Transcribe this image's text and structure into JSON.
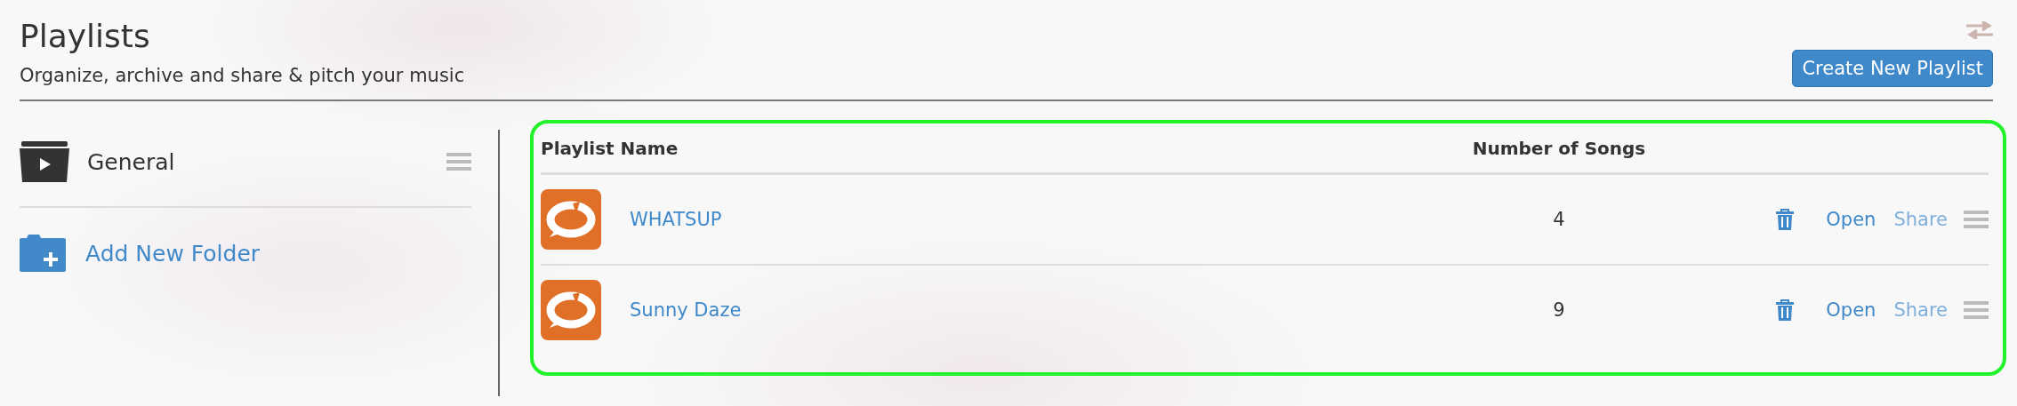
{
  "header": {
    "title": "Playlists",
    "subtitle": "Organize, archive and share & pitch your music",
    "create_button": "Create New Playlist"
  },
  "sidebar": {
    "folders": [
      {
        "name": "General"
      }
    ],
    "add_folder": "Add New Folder"
  },
  "table": {
    "columns": [
      "Playlist Name",
      "Number of Songs"
    ],
    "rows": [
      {
        "name": "WHATSUP",
        "songs": "4",
        "open": "Open",
        "share": "Share"
      },
      {
        "name": "Sunny Daze",
        "songs": "9",
        "open": "Open",
        "share": "Share"
      }
    ]
  }
}
